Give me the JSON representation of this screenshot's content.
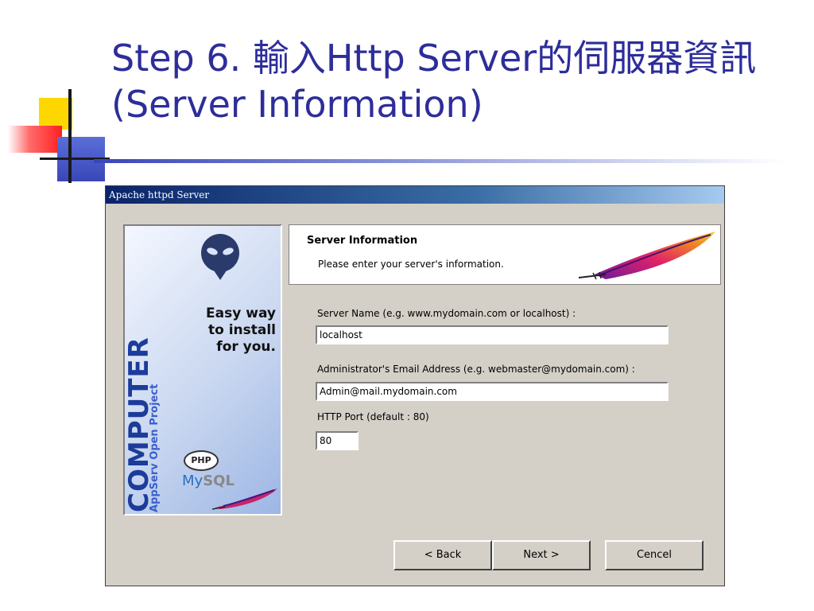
{
  "slide": {
    "title": "Step 6. 輸入Http Server的伺服器資訊(Server Information)"
  },
  "window": {
    "title": "Apache httpd Server",
    "side_panel": {
      "brand": "COMPUTER",
      "subtitle": "AppServ Open Project",
      "tagline_line1": "Easy way",
      "tagline_line2": "to install",
      "tagline_line3": "for you.",
      "php_logo": "PHP",
      "mysql_logo_a": "My",
      "mysql_logo_b": "SQL"
    },
    "header": {
      "title": "Server Information",
      "subtitle": "Please enter your server's information."
    },
    "fields": {
      "server_name_label": "Server Name (e.g. www.mydomain.com or localhost) :",
      "server_name_value": "localhost",
      "email_label": "Administrator's Email Address (e.g. webmaster@mydomain.com) :",
      "email_value": "Admin@mail.mydomain.com",
      "port_label": "HTTP Port (default : 80)",
      "port_value": "80"
    },
    "buttons": {
      "back": "< Back",
      "next": "Next >",
      "cancel": "Cencel"
    }
  },
  "colors": {
    "title_text": "#2d2d9a",
    "titlebar_start": "#0a246a",
    "dialog_face": "#d4d0c8"
  },
  "icons": [
    "alien-icon",
    "feather-icon",
    "php-logo",
    "mysql-logo"
  ]
}
